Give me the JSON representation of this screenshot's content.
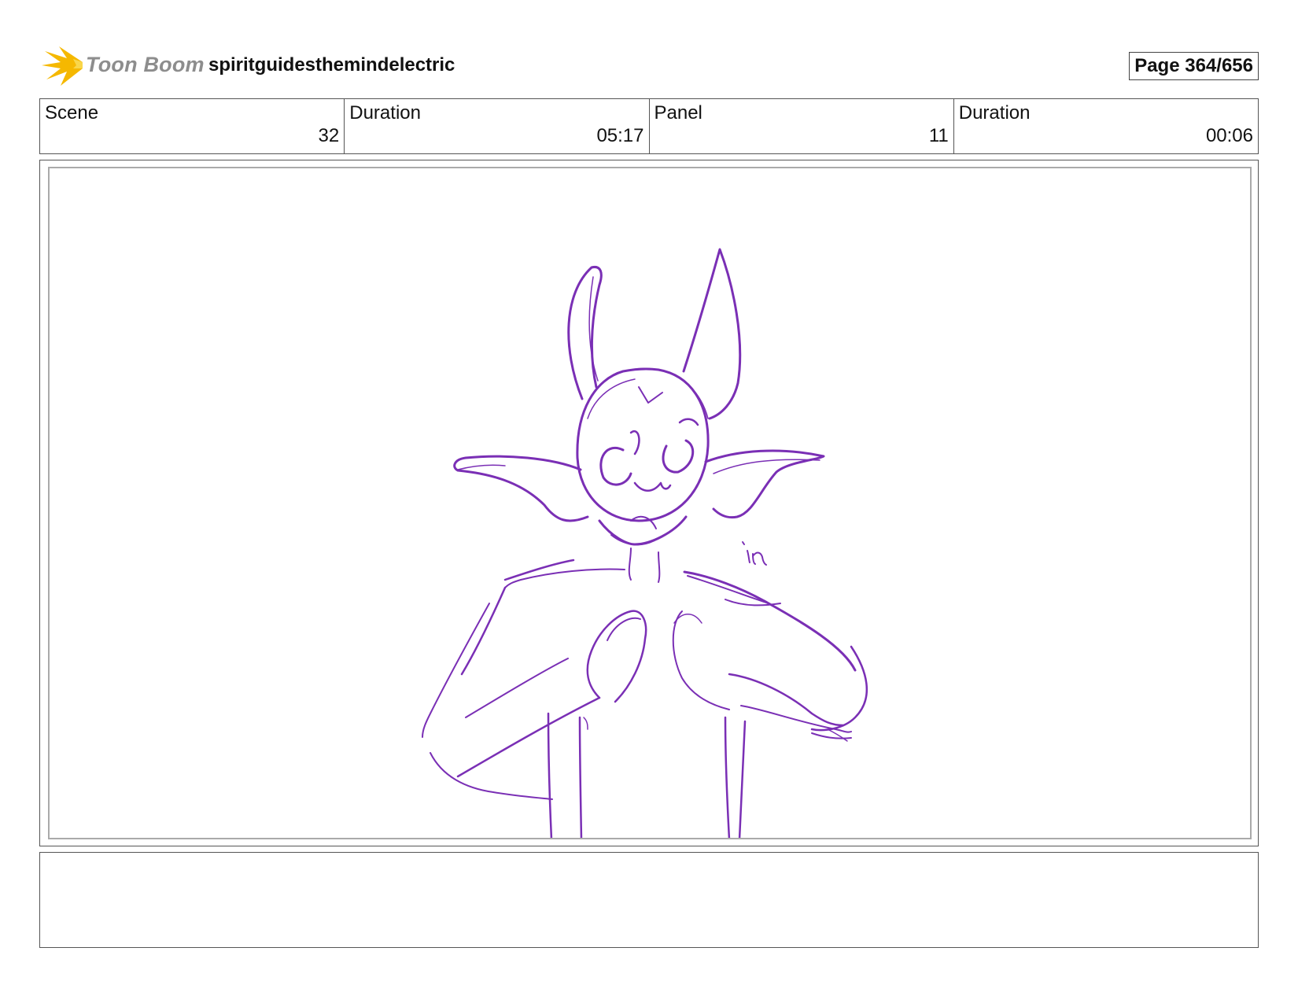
{
  "header": {
    "logo_text": "Toon Boom",
    "project_title": "spiritguidesthemindelectric",
    "page_label": "Page 364/656"
  },
  "info": {
    "scene_label": "Scene",
    "scene_value": "32",
    "scene_duration_label": "Duration",
    "scene_duration_value": "05:17",
    "panel_label": "Panel",
    "panel_value": "11",
    "panel_duration_label": "Duration",
    "panel_duration_value": "00:06"
  },
  "sketch": {
    "stroke_color": "#7a2fb5",
    "annotation": "in"
  },
  "colors": {
    "logo_star": "#f5b800",
    "logo_text": "#8d8d8d"
  },
  "notes": ""
}
